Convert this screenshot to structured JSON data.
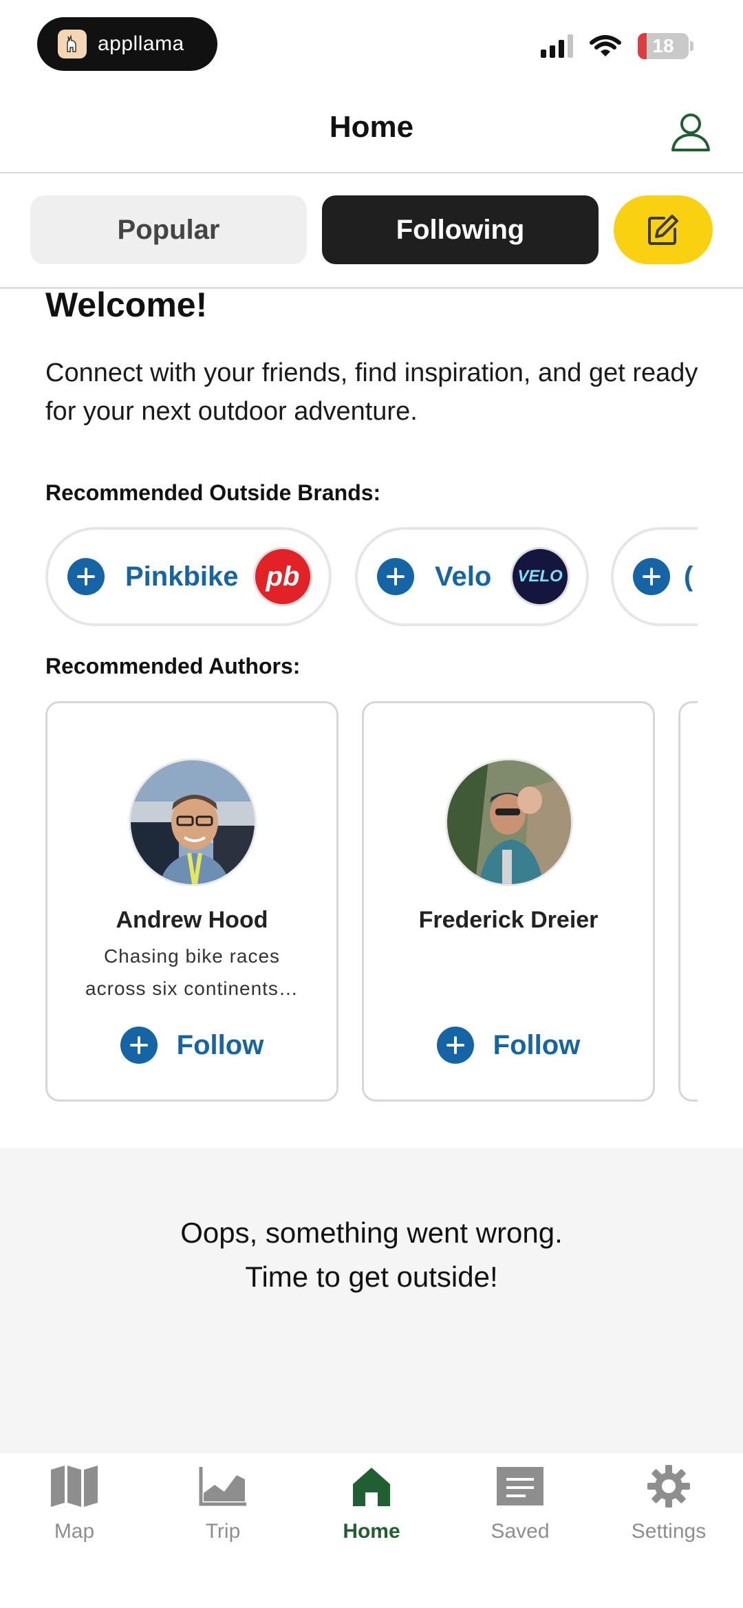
{
  "status_bar": {
    "app_badge": "appllama",
    "battery": "18",
    "battery_fraction": 0.18
  },
  "header": {
    "title": "Home"
  },
  "tabs": {
    "popular": "Popular",
    "following": "Following",
    "active": "Following"
  },
  "welcome": {
    "title": "Welcome!",
    "text": "Connect with your friends, find inspiration, and get ready for your next outdoor adventure."
  },
  "brands": {
    "label": "Recommended Outside Brands:",
    "items": [
      {
        "name": "Pinkbike",
        "logo_text": "pb",
        "logo_color": "#e32227"
      },
      {
        "name": "Velo",
        "logo_text": "VELO",
        "logo_color": "#14163f"
      },
      {
        "name": "",
        "logo_text": "",
        "logo_color": "#1565a6"
      }
    ]
  },
  "authors": {
    "label": "Recommended Authors:",
    "items": [
      {
        "name": "Andrew Hood",
        "bio": "Chasing bike races across six continents…",
        "follow": "Follow"
      },
      {
        "name": "Frederick Dreier",
        "bio": "",
        "follow": "Follow"
      }
    ]
  },
  "error": {
    "line1": "Oops, something went wrong.",
    "line2": "Time to get outside!"
  },
  "bottom_nav": {
    "items": [
      {
        "label": "Map",
        "icon": "map-icon"
      },
      {
        "label": "Trip",
        "icon": "chart-icon"
      },
      {
        "label": "Home",
        "icon": "home-icon"
      },
      {
        "label": "Saved",
        "icon": "saved-icon"
      },
      {
        "label": "Settings",
        "icon": "gear-icon"
      }
    ],
    "active": "Home"
  },
  "colors": {
    "accent_blue": "#1565a6",
    "active_green": "#1f5f32",
    "compose_yellow": "#f9d111",
    "dark_tab": "#1f1f1f"
  }
}
